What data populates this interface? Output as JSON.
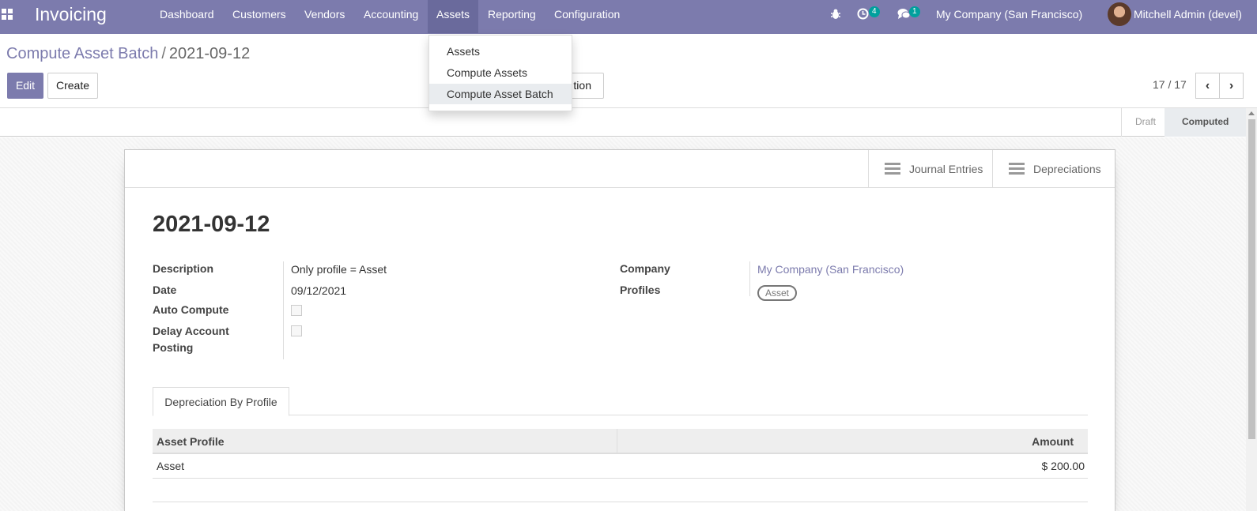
{
  "navbar": {
    "brand": "Invoicing",
    "menu": [
      "Dashboard",
      "Customers",
      "Vendors",
      "Accounting",
      "Assets",
      "Reporting",
      "Configuration"
    ],
    "active_menu": "Assets",
    "activity_count": "4",
    "message_count": "1",
    "company": "My Company (San Francisco)",
    "user": "Mitchell Admin (devel)",
    "icons": [
      "apps-grid-icon",
      "bug-icon",
      "clock-icon",
      "chat-icon"
    ]
  },
  "dropdown": {
    "items": [
      "Assets",
      "Compute Assets",
      "Compute Asset Batch"
    ],
    "highlighted": "Compute Asset Batch"
  },
  "breadcrumb": {
    "parent": "Compute Asset Batch",
    "separator": "/",
    "current": "2021-09-12"
  },
  "buttons": {
    "edit": "Edit",
    "create": "Create",
    "action_partial": "tion"
  },
  "pager": {
    "value": "17 / 17",
    "prev_icon": "chevron-left-icon",
    "next_icon": "chevron-right-icon"
  },
  "statusbar": {
    "states": [
      "Draft",
      "Computed"
    ],
    "current": "Computed"
  },
  "smart_buttons": [
    "Journal Entries",
    "Depreciations"
  ],
  "record": {
    "title": "2021-09-12",
    "fields": {
      "description_label": "Description",
      "description": "Only profile = Asset",
      "date_label": "Date",
      "date": "09/12/2021",
      "auto_compute_label": "Auto Compute",
      "delay_posting_label_1": "Delay Account",
      "delay_posting_label_2": "Posting",
      "company_label": "Company",
      "company": "My Company (San Francisco)",
      "profiles_label": "Profiles",
      "profile_tag": "Asset"
    }
  },
  "tab": {
    "label": "Depreciation By Profile"
  },
  "table": {
    "columns": [
      "Asset Profile",
      "Amount"
    ],
    "rows": [
      {
        "profile": "Asset",
        "amount": "$ 200.00"
      }
    ]
  },
  "colors": {
    "brand": "#7c7bad",
    "badge": "#00a09d"
  }
}
